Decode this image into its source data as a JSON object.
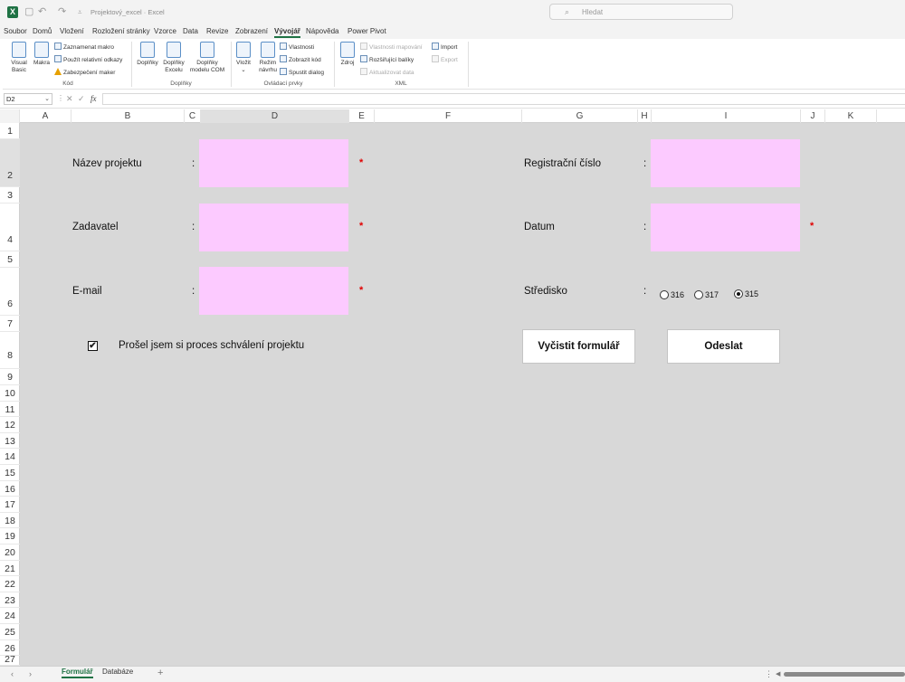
{
  "titlebar": {
    "doc_title": "Projektový_excel · Excel",
    "search_placeholder": "Hledat"
  },
  "menu": [
    "Soubor",
    "Domů",
    "Vložení",
    "Rozložení stránky",
    "Vzorce",
    "Data",
    "Revize",
    "Zobrazení",
    "Vývojář",
    "Nápověda",
    "Power Pivot"
  ],
  "ribbon": {
    "kod": {
      "visual_basic": "Visual Basic",
      "makra": "Makra",
      "record": "Zaznamenat makro",
      "relative": "Použít relativní odkazy",
      "security": "Zabezpečení maker",
      "group": "Kód"
    },
    "doplnky": {
      "addins": "Doplňky",
      "excel_addins": "Doplňky Excelu",
      "com_addins": "Doplňky modelu COM",
      "group": "Doplňky"
    },
    "ovladaci": {
      "insert": "Vložit",
      "design": "Režim návrhu",
      "properties": "Vlastnosti",
      "view_code": "Zobrazit kód",
      "dialog": "Spustit dialog",
      "group": "Ovládací prvky"
    },
    "xml": {
      "source": "Zdroj",
      "map_props": "Vlastnosti mapování",
      "packs": "Rozšiřující balíky",
      "refresh": "Aktualizovat data",
      "import": "Import",
      "export": "Export",
      "group": "XML"
    }
  },
  "formula_bar": {
    "name_box": "D2",
    "fx": "fx"
  },
  "columns": [
    "A",
    "B",
    "C",
    "D",
    "E",
    "F",
    "G",
    "H",
    "I",
    "J",
    "K"
  ],
  "rows": [
    "1",
    "2",
    "3",
    "4",
    "5",
    "6",
    "7",
    "8",
    "9",
    "10",
    "11",
    "12",
    "13",
    "14",
    "15",
    "16",
    "17",
    "18",
    "19",
    "20",
    "21",
    "22",
    "23",
    "24",
    "25",
    "26",
    "27"
  ],
  "form": {
    "colon": ":",
    "required_mark": "*",
    "project_name_label": "Název projektu",
    "applicant_label": "Zadavatel",
    "email_label": "E-mail",
    "reg_number_label": "Registrační číslo",
    "date_label": "Datum",
    "center_label": "Středisko",
    "center_options": [
      "316",
      "317",
      "315"
    ],
    "center_selected": "315",
    "approval_checkbox_label": "Prošel jsem si proces schválení projektu",
    "approval_checked": true,
    "checkmark": "✔",
    "clear_button": "Vyčistit formulář",
    "submit_button": "Odeslat",
    "field_color": "#fccaff",
    "required_color": "#e00000"
  },
  "sheets": {
    "tabs": [
      "Formulář",
      "Databáze"
    ],
    "active": "Formulář",
    "add": "+"
  }
}
